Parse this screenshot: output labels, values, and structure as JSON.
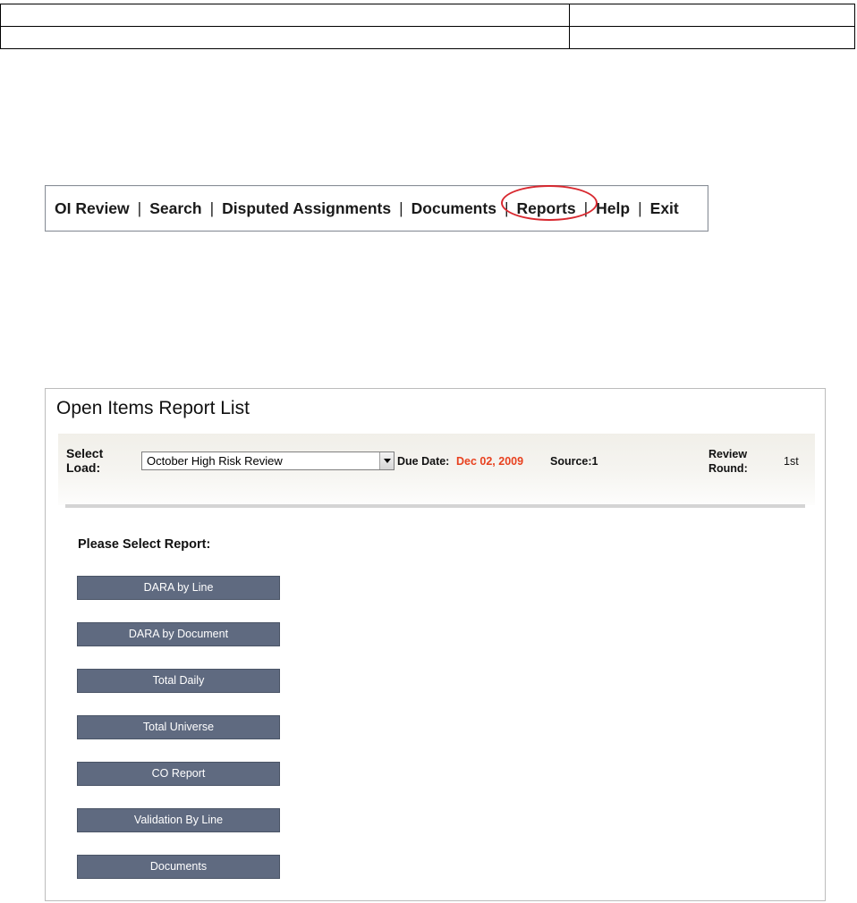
{
  "nav": {
    "items": [
      "OI Review",
      "Search",
      "Disputed Assignments",
      "Documents",
      "Reports",
      "Help",
      "Exit"
    ],
    "separator": "|",
    "highlighted": "Reports",
    "highlight_color": "#d8282f"
  },
  "panel": {
    "title": "Open Items Report List",
    "select_load_label": "Select Load:",
    "load_value": "October High Risk Review",
    "due_date_label": "Due Date:",
    "due_date_value": "Dec 02, 2009",
    "due_date_color": "#e8411f",
    "source_label": "Source:1",
    "review_round_label": "Review Round:",
    "review_round_value": "1st",
    "report_heading": "Please Select Report:",
    "reports": [
      "DARA by Line",
      "DARA by Document",
      "Total Daily",
      "Total Universe",
      "CO Report",
      "Validation By Line",
      "Documents"
    ],
    "button_color": "#5f6a80"
  }
}
